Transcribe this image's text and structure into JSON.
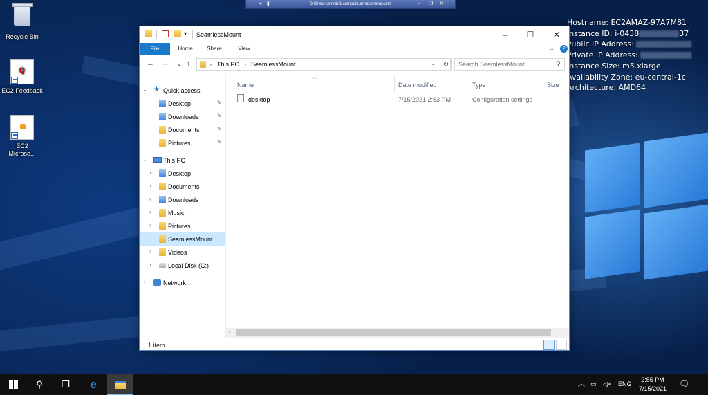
{
  "remote_bar": {
    "title": "3-33.eu-central-1.compute.amazonaws.com"
  },
  "desktop": {
    "icons": [
      {
        "label": "Recycle Bin",
        "icon": "recycle-bin-icon"
      },
      {
        "label": "EC2 Feedback",
        "icon": "ec2-feedback-icon"
      },
      {
        "label": "EC2 Microso...",
        "icon": "ec2-microsoft-icon"
      }
    ]
  },
  "instance_info": {
    "hostname_label": "Hostname:",
    "hostname": "EC2AMAZ-97A7M81",
    "instance_id_label": "Instance ID:",
    "instance_id_prefix": "i-0438",
    "instance_id_suffix": "37",
    "public_ip_label": "Public IP Address:",
    "private_ip_label": "Private IP Address:",
    "instance_size_label": "Instance Size:",
    "instance_size": "m5.xlarge",
    "availability_zone_label": "Availability Zone:",
    "availability_zone": "eu-central-1c",
    "architecture_label": "Architecture:",
    "architecture": "AMD64"
  },
  "explorer": {
    "title": "SeamlessMount",
    "ribbon_tabs": [
      "File",
      "Home",
      "Share",
      "View"
    ],
    "address": {
      "crumbs": [
        "This PC",
        "SeamlessMount"
      ]
    },
    "search_placeholder": "Search SeamlessMount",
    "nav": {
      "quick_access": "Quick access",
      "quick_items": [
        "Desktop",
        "Downloads",
        "Documents",
        "Pictures"
      ],
      "this_pc": "This PC",
      "pc_items": [
        "Desktop",
        "Documents",
        "Downloads",
        "Music",
        "Pictures",
        "SeamlessMount",
        "Videos",
        "Local Disk (C:)"
      ],
      "network": "Network",
      "selected": "SeamlessMount"
    },
    "columns": [
      "Name",
      "Date modified",
      "Type",
      "Size"
    ],
    "files": [
      {
        "name": "desktop",
        "date": "7/15/2021 2:53 PM",
        "type": "Configuration settings"
      }
    ],
    "status": "1 item"
  },
  "taskbar": {
    "language": "ENG",
    "time": "2:55 PM",
    "date": "7/15/2021"
  }
}
